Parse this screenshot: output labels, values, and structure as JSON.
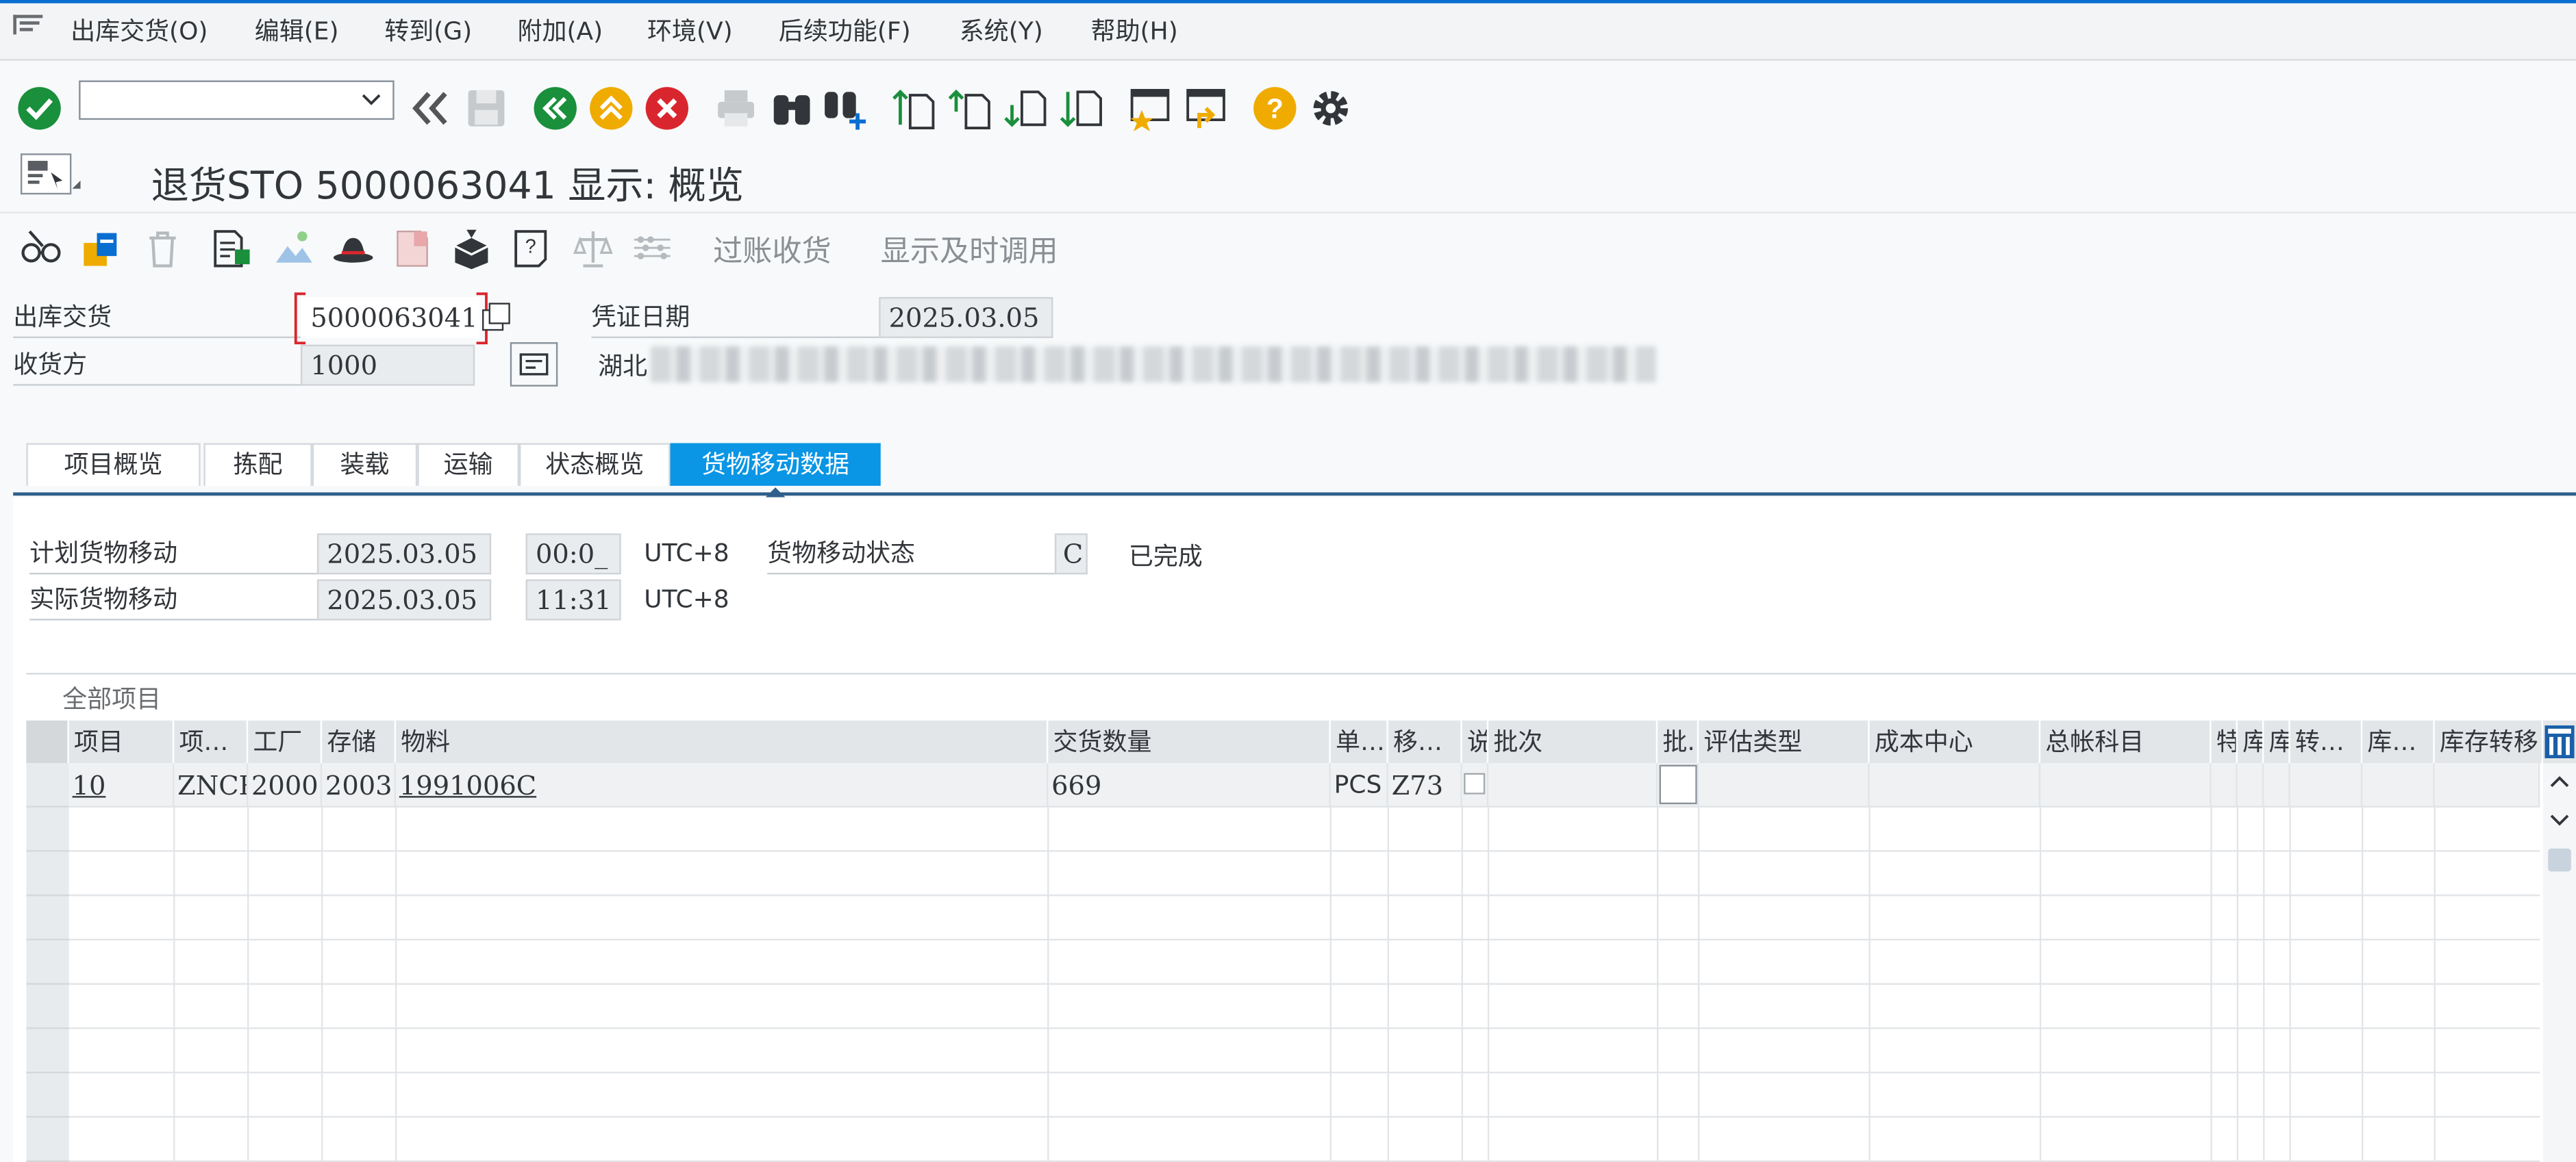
{
  "menu": [
    "出库交货(O)",
    "编辑(E)",
    "转到(G)",
    "附加(A)",
    "环境(V)",
    "后续功能(F)",
    "系统(Y)",
    "帮助(H)"
  ],
  "title": "退货STO 5000063041 显示: 概览",
  "app_toolbar": {
    "post_gr": "过账收货",
    "display_timely": "显示及时调用"
  },
  "header": {
    "delivery_label": "出库交货",
    "delivery_value": "5000063041",
    "doc_date_label": "凭证日期",
    "doc_date_value": "2025.03.05",
    "recipient_label": "收货方",
    "recipient_value": "1000",
    "recipient_name_prefix": "湖北"
  },
  "tabs": [
    "项目概览",
    "拣配",
    "装载",
    "运输",
    "状态概览",
    "货物移动数据"
  ],
  "active_tab": 5,
  "goods_movement": {
    "planned_label": "计划货物移动",
    "planned_date": "2025.03.05",
    "planned_time": "00:0_",
    "planned_tz": "UTC+8",
    "actual_label": "实际货物移动",
    "actual_date": "2025.03.05",
    "actual_time": "11:31",
    "actual_tz": "UTC+8",
    "status_label": "货物移动状态",
    "status_code": "C",
    "status_text": "已完成"
  },
  "table": {
    "title": "全部项目",
    "columns": [
      "项目",
      "项…",
      "工厂",
      "存储",
      "物料",
      "交货数量",
      "单…",
      "移…",
      "说",
      "批次",
      "批.",
      "评估类型",
      "成本中心",
      "总帐科目",
      "特",
      "库",
      "库",
      "转…",
      "库…",
      "库存转移"
    ],
    "rows": [
      {
        "item": "10",
        "cat": "ZNCR",
        "plant": "2000",
        "sloc": "2003",
        "material": "1991006C",
        "qty": "669",
        "unit": "PCS",
        "mvt": "Z73"
      }
    ]
  },
  "colors": {
    "accent": "#0a95e5",
    "ok_green": "#1a8f3c",
    "orange": "#f0ab00",
    "red": "#d9262e"
  }
}
